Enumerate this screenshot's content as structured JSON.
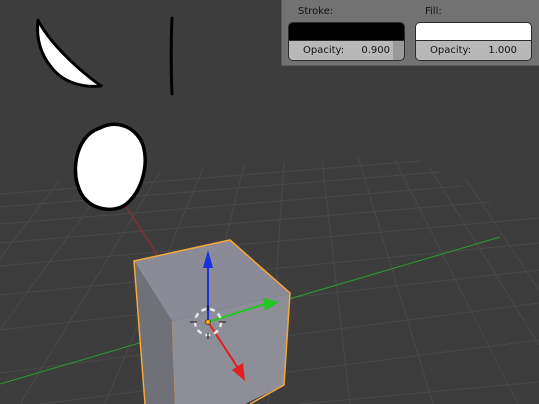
{
  "grease_pencil_panel": {
    "stroke": {
      "label": "Stroke:",
      "color": "#000000",
      "opacity_label": "Opacity:",
      "opacity_value": "0.900",
      "opacity": 0.9
    },
    "fill": {
      "label": "Fill:",
      "color": "#ffffff",
      "opacity_label": "Opacity:",
      "opacity_value": "1.000",
      "opacity": 1.0
    }
  },
  "viewport": {
    "background": "#3d3d3d",
    "grid_color": "#4a4a4a",
    "x_axis_color": "#a02c2c",
    "y_axis_color": "#2f9a2f",
    "selection_outline_color": "#f5a83a",
    "gizmo": {
      "z_color": "#1b2fe0",
      "y_color": "#20c820",
      "x_color": "#e02020"
    }
  }
}
